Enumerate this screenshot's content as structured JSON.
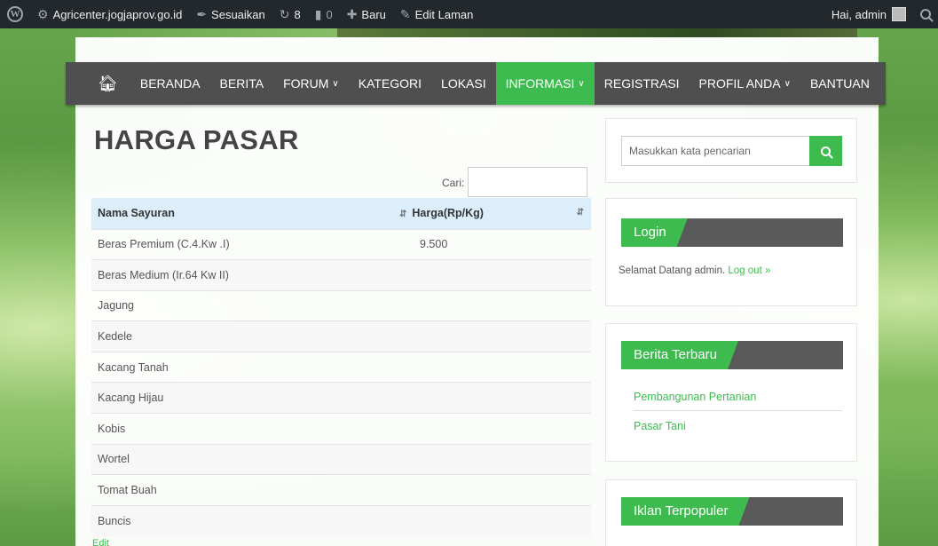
{
  "adminbar": {
    "site": "Agricenter.jogjaprov.go.id",
    "customize": "Sesuaikan",
    "updates": "8",
    "comments": "0",
    "new": "Baru",
    "edit": "Edit Laman",
    "greeting": "Hai, admin"
  },
  "nav": {
    "items": [
      "BERANDA",
      "BERITA",
      "FORUM",
      "KATEGORI",
      "LOKASI",
      "INFORMASI",
      "REGISTRASI",
      "PROFIL ANDA",
      "BANTUAN"
    ],
    "active": "INFORMASI",
    "accent": "#3dbb4f"
  },
  "main": {
    "title": "HARGA PASAR",
    "search_label": "Cari:",
    "table": {
      "headers": [
        "Nama Sayuran",
        "Harga(Rp/Kg)"
      ],
      "rows": [
        [
          "Beras Premium (C.4.Kw .I)",
          "9.500"
        ],
        [
          "Beras Medium (Ir.64 Kw II)",
          ""
        ],
        [
          "Jagung",
          ""
        ],
        [
          "Kedele",
          ""
        ],
        [
          "Kacang Tanah",
          ""
        ],
        [
          "Kacang Hijau",
          ""
        ],
        [
          "Kobis",
          ""
        ],
        [
          "Wortel",
          ""
        ],
        [
          "Tomat Buah",
          ""
        ],
        [
          "Buncis",
          ""
        ]
      ]
    },
    "edit_link": "Edit"
  },
  "sidebar": {
    "search_placeholder": "Masukkan kata pencarian",
    "login": {
      "title": "Login",
      "message": "Selamat Datang admin.",
      "logout": "Log out »"
    },
    "news": {
      "title": "Berita Terbaru",
      "items": [
        "Pembangunan Pertanian",
        "Pasar Tani"
      ]
    },
    "ads": {
      "title": "Iklan Terpopuler"
    }
  }
}
